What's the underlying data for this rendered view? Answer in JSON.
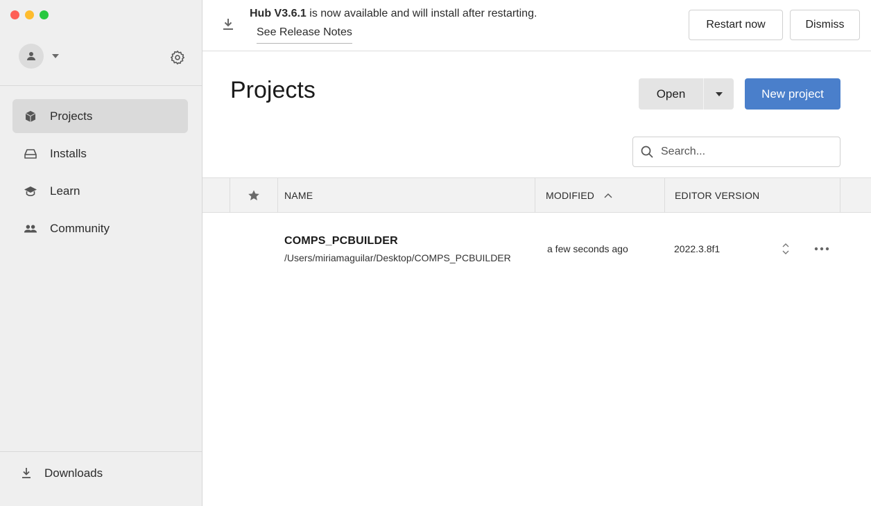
{
  "window": {
    "controls": [
      "close",
      "minimize",
      "zoom"
    ]
  },
  "sidebar": {
    "account_icon": "person-icon",
    "settings_icon": "gear-icon",
    "items": [
      {
        "label": "Projects",
        "icon": "cube-icon",
        "active": true
      },
      {
        "label": "Installs",
        "icon": "drive-icon",
        "active": false
      },
      {
        "label": "Learn",
        "icon": "graduation-cap-icon",
        "active": false
      },
      {
        "label": "Community",
        "icon": "people-icon",
        "active": false
      }
    ],
    "downloads_label": "Downloads"
  },
  "banner": {
    "bold_text": "Hub V3.6.1",
    "text": " is now available and will install after restarting.",
    "link": "See Release Notes",
    "restart_label": "Restart now",
    "dismiss_label": "Dismiss"
  },
  "main": {
    "title": "Projects",
    "open_label": "Open",
    "new_project_label": "New project",
    "search_placeholder": "Search..."
  },
  "table": {
    "columns": {
      "name": "NAME",
      "modified": "MODIFIED",
      "editor_version": "EDITOR VERSION"
    },
    "sort": {
      "column": "modified",
      "direction": "ascending"
    },
    "rows": [
      {
        "name": "COMPS_PCBUILDER",
        "path": "/Users/miriamaguilar/Desktop/COMPS_PCBUILDER",
        "modified": "a few seconds ago",
        "editor_version": "2022.3.8f1"
      }
    ]
  },
  "colors": {
    "accent": "#4a7fcb",
    "sidebar_bg": "#efefef",
    "active_item_bg": "#dadada",
    "traffic_red": "#fe5f57",
    "traffic_yellow": "#febc2e",
    "traffic_green": "#28c840"
  }
}
